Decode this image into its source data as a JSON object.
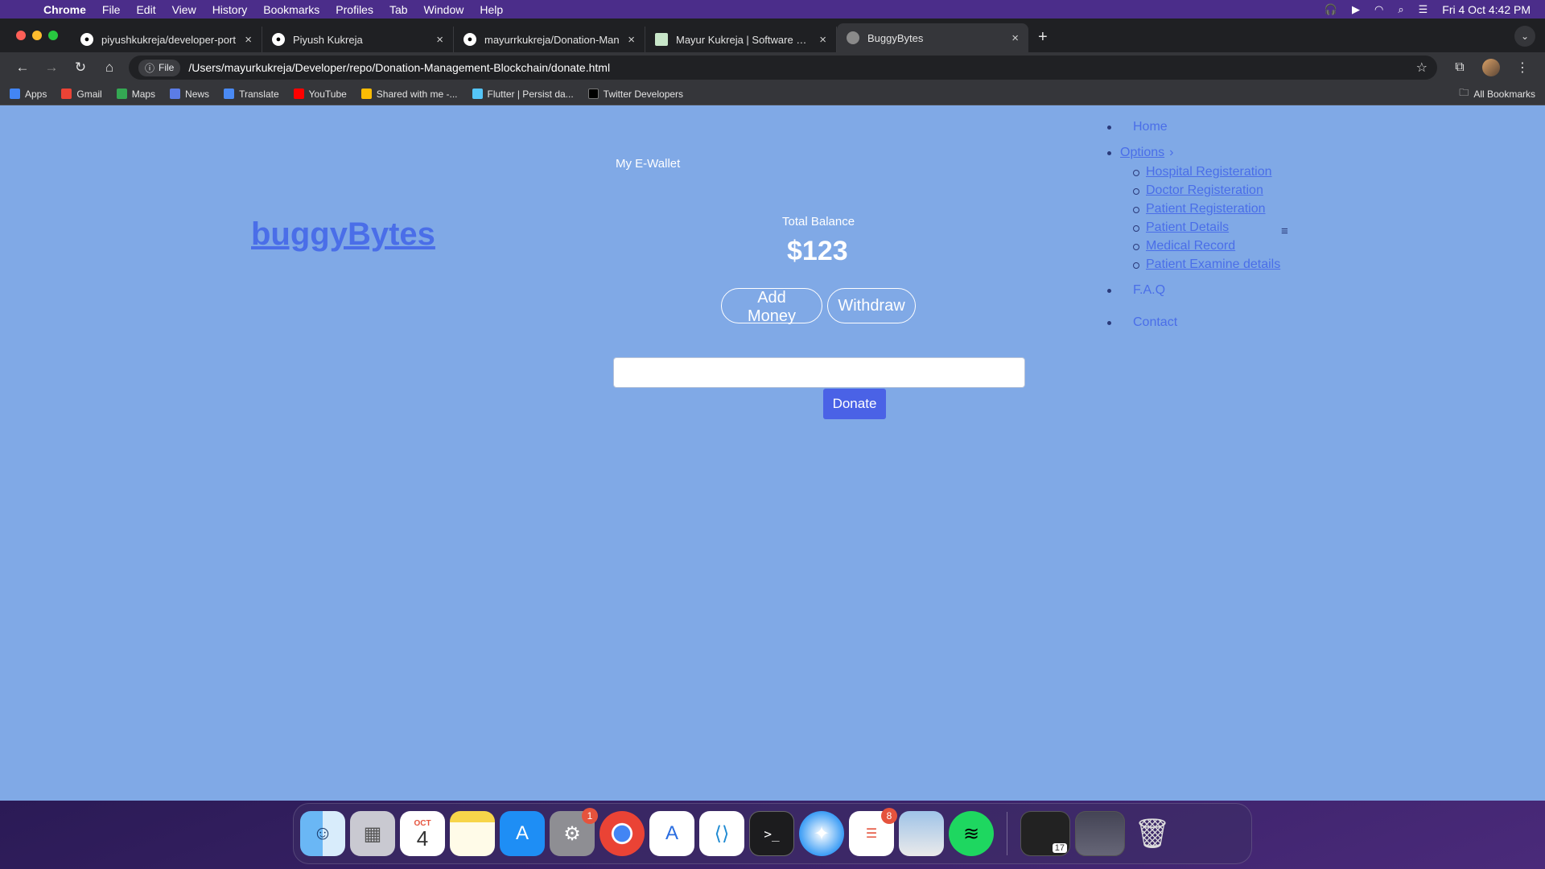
{
  "menubar": {
    "app": "Chrome",
    "items": [
      "File",
      "Edit",
      "View",
      "History",
      "Bookmarks",
      "Profiles",
      "Tab",
      "Window",
      "Help"
    ],
    "datetime": "Fri 4 Oct  4:42 PM"
  },
  "tabs": [
    {
      "title": "piyushkukreja/developer-port",
      "icon": "github-icon"
    },
    {
      "title": "Piyush Kukreja",
      "icon": "globe-icon"
    },
    {
      "title": "mayurrkukreja/Donation-Man",
      "icon": "github-icon"
    },
    {
      "title": "Mayur Kukreja | Software Eng",
      "icon": "document-icon"
    },
    {
      "title": "BuggyBytes",
      "icon": "globe-icon",
      "active": true
    }
  ],
  "omnibox": {
    "chip": "File",
    "url": "/Users/mayurkukreja/Developer/repo/Donation-Management-Blockchain/donate.html"
  },
  "bookmarks": {
    "items": [
      "Apps",
      "Gmail",
      "Maps",
      "News",
      "Translate",
      "YouTube",
      "Shared with me -...",
      "Flutter | Persist da...",
      "Twitter Developers"
    ],
    "all": "All Bookmarks"
  },
  "page": {
    "logo": "buggyBytes",
    "wallet_title": "My E-Wallet",
    "balance_label": "Total Balance",
    "balance_value": "$123",
    "add_money": "Add Money",
    "withdraw": "Withdraw",
    "donate": "Donate",
    "amount_value": ""
  },
  "nav": {
    "home": "Home",
    "options": "Options",
    "sub": [
      "Hospital Registeration",
      "Doctor Registeration",
      "Patient Registeration",
      "Patient Details",
      "Medical Record",
      "Patient Examine details"
    ],
    "faq": "F.A.Q",
    "contact": "Contact"
  },
  "dock": {
    "calendar_month": "OCT",
    "calendar_day": "4",
    "settings_badge": "1",
    "reminders_badge": "8",
    "calendar_thumb_day": "17"
  },
  "colors": {
    "page_bg": "#80a9e6",
    "link": "#4a6ee8",
    "donate_bg": "#4a62e6"
  }
}
